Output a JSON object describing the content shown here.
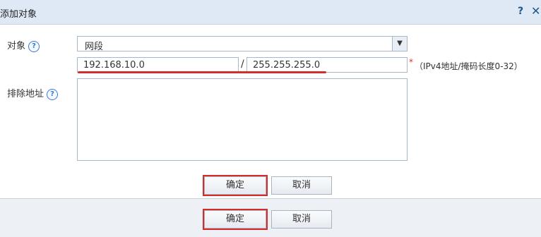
{
  "dialog": {
    "title": "添加对象",
    "help_label": "?",
    "close_label": "✕"
  },
  "form": {
    "object_label": "对象",
    "object_help": "?",
    "object_value": "网段",
    "ip_value": "192.168.10.0",
    "slash": "/",
    "mask_value": "255.255.255.0",
    "required_mark": "*",
    "hint": "（IPv4地址/掩码长度0-32）",
    "exclude_label": "排除地址",
    "exclude_help": "?",
    "exclude_value": ""
  },
  "buttons": {
    "confirm": "确定",
    "cancel": "取消"
  },
  "footer": {
    "confirm": "确定",
    "cancel": "取消"
  },
  "colors": {
    "highlight": "#d52b2b",
    "titlebar": "#dfe9f5"
  }
}
